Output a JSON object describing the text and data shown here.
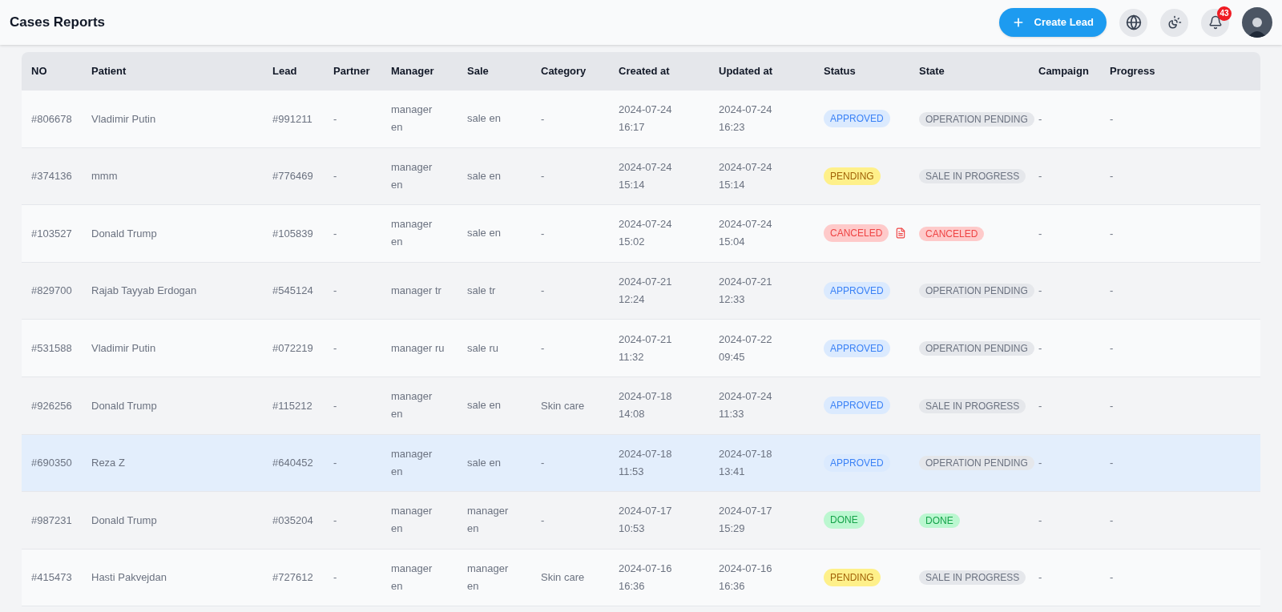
{
  "header": {
    "title": "Cases Reports",
    "create_button": "Create Lead",
    "notification_count": "43"
  },
  "table": {
    "columns": [
      "NO",
      "Patient",
      "Lead",
      "Partner",
      "Manager",
      "Sale",
      "Category",
      "Created at",
      "Updated at",
      "Status",
      "State",
      "Campaign",
      "Progress"
    ],
    "rows": [
      {
        "selected": false,
        "no": "#806678",
        "patient": "Vladimir Putin",
        "lead": "#991211",
        "partner": "-",
        "manager": [
          "manager",
          "en"
        ],
        "sale": [
          "sale en"
        ],
        "category": "-",
        "created": [
          "2024-07-24",
          "16:17"
        ],
        "updated": [
          "2024-07-24",
          "16:23"
        ],
        "status": {
          "label": "APPROVED",
          "kind": "approved",
          "document": false
        },
        "state": {
          "label": "OPERATION PENDING",
          "kind": "neutral"
        },
        "campaign": "-",
        "progress": "-"
      },
      {
        "selected": false,
        "no": "#374136",
        "patient": "mmm",
        "lead": "#776469",
        "partner": "-",
        "manager": [
          "manager",
          "en"
        ],
        "sale": [
          "sale en"
        ],
        "category": "-",
        "created": [
          "2024-07-24",
          "15:14"
        ],
        "updated": [
          "2024-07-24",
          "15:14"
        ],
        "status": {
          "label": "PENDING",
          "kind": "pending",
          "document": false
        },
        "state": {
          "label": "SALE IN PROGRESS",
          "kind": "neutral"
        },
        "campaign": "-",
        "progress": "-"
      },
      {
        "selected": false,
        "no": "#103527",
        "patient": "Donald Trump",
        "lead": "#105839",
        "partner": "-",
        "manager": [
          "manager",
          "en"
        ],
        "sale": [
          "sale en"
        ],
        "category": "-",
        "created": [
          "2024-07-24",
          "15:02"
        ],
        "updated": [
          "2024-07-24",
          "15:04"
        ],
        "status": {
          "label": "CANCELED",
          "kind": "canceled",
          "document": true
        },
        "state": {
          "label": "CANCELED",
          "kind": "canceled"
        },
        "campaign": "-",
        "progress": "-"
      },
      {
        "selected": false,
        "no": "#829700",
        "patient": "Rajab Tayyab Erdogan",
        "lead": "#545124",
        "partner": "-",
        "manager": [
          "manager tr"
        ],
        "sale": [
          "sale tr"
        ],
        "category": "-",
        "created": [
          "2024-07-21",
          "12:24"
        ],
        "updated": [
          "2024-07-21",
          "12:33"
        ],
        "status": {
          "label": "APPROVED",
          "kind": "approved",
          "document": false
        },
        "state": {
          "label": "OPERATION PENDING",
          "kind": "neutral"
        },
        "campaign": "-",
        "progress": "-"
      },
      {
        "selected": false,
        "no": "#531588",
        "patient": "Vladimir Putin",
        "lead": "#072219",
        "partner": "-",
        "manager": [
          "manager ru"
        ],
        "sale": [
          "sale ru"
        ],
        "category": "-",
        "created": [
          "2024-07-21",
          "11:32"
        ],
        "updated": [
          "2024-07-22",
          "09:45"
        ],
        "status": {
          "label": "APPROVED",
          "kind": "approved",
          "document": false
        },
        "state": {
          "label": "OPERATION PENDING",
          "kind": "neutral"
        },
        "campaign": "-",
        "progress": "-"
      },
      {
        "selected": false,
        "no": "#926256",
        "patient": "Donald Trump",
        "lead": "#115212",
        "partner": "-",
        "manager": [
          "manager",
          "en"
        ],
        "sale": [
          "sale en"
        ],
        "category": "Skin care",
        "created": [
          "2024-07-18",
          "14:08"
        ],
        "updated": [
          "2024-07-24",
          "11:33"
        ],
        "status": {
          "label": "APPROVED",
          "kind": "approved",
          "document": false
        },
        "state": {
          "label": "SALE IN PROGRESS",
          "kind": "neutral"
        },
        "campaign": "-",
        "progress": "-"
      },
      {
        "selected": true,
        "no": "#690350",
        "patient": "Reza Z",
        "lead": "#640452",
        "partner": "-",
        "manager": [
          "manager",
          "en"
        ],
        "sale": [
          "sale en"
        ],
        "category": "-",
        "created": [
          "2024-07-18",
          "11:53"
        ],
        "updated": [
          "2024-07-18",
          "13:41"
        ],
        "status": {
          "label": "APPROVED",
          "kind": "approved",
          "document": false
        },
        "state": {
          "label": "OPERATION PENDING",
          "kind": "neutral"
        },
        "campaign": "-",
        "progress": "-"
      },
      {
        "selected": false,
        "no": "#987231",
        "patient": "Donald Trump",
        "lead": "#035204",
        "partner": "-",
        "manager": [
          "manager",
          "en"
        ],
        "sale": [
          "manager",
          "en"
        ],
        "category": "-",
        "created": [
          "2024-07-17",
          "10:53"
        ],
        "updated": [
          "2024-07-17",
          "15:29"
        ],
        "status": {
          "label": "DONE",
          "kind": "done",
          "document": false
        },
        "state": {
          "label": "DONE",
          "kind": "done"
        },
        "campaign": "-",
        "progress": "-"
      },
      {
        "selected": false,
        "no": "#415473",
        "patient": "Hasti Pakvejdan",
        "lead": "#727612",
        "partner": "-",
        "manager": [
          "manager",
          "en"
        ],
        "sale": [
          "manager",
          "en"
        ],
        "category": "Skin care",
        "created": [
          "2024-07-16",
          "16:36"
        ],
        "updated": [
          "2024-07-16",
          "16:36"
        ],
        "status": {
          "label": "PENDING",
          "kind": "pending",
          "document": false
        },
        "state": {
          "label": "SALE IN PROGRESS",
          "kind": "neutral"
        },
        "campaign": "-",
        "progress": "-"
      }
    ]
  }
}
